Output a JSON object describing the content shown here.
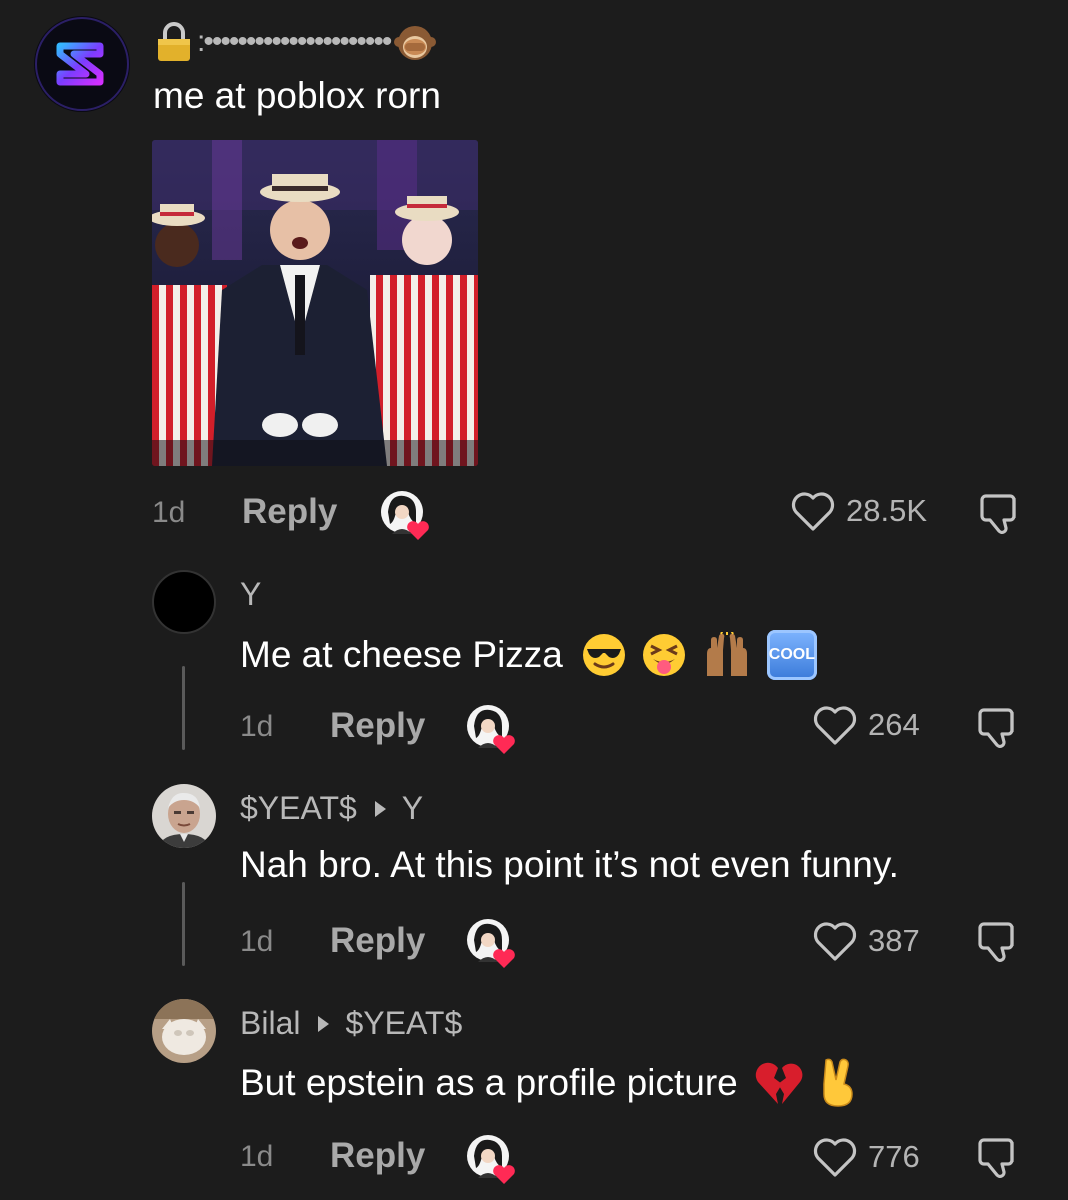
{
  "colors": {
    "background": "#1c1c1c",
    "text_primary": "#ffffff",
    "text_muted": "#a9a9a9",
    "heart_badge": "#ff2a55",
    "app_logo_accent": "#7b3dff"
  },
  "comments": [
    {
      "username": ":••••••••••••••••••••••",
      "username_icons": [
        "lock-icon",
        "see-no-evil-monkey-icon"
      ],
      "text": "me at poblox rorn",
      "has_image": true,
      "image_description": "meme-image",
      "age": "1d",
      "reply_label": "Reply",
      "likes": "28.5K"
    },
    {
      "username": "Y",
      "text": "Me at cheese Pizza",
      "emojis": [
        "sunglasses-emoji",
        "squinting-tongue-emoji",
        "raised-hands-emoji",
        "cool-button-emoji"
      ],
      "cool_label": "COOL",
      "age": "1d",
      "reply_label": "Reply",
      "likes": "264"
    },
    {
      "username": "$YEAT$",
      "reply_to": "Y",
      "text": "Nah bro. At this point it’s not even funny.",
      "age": "1d",
      "reply_label": "Reply",
      "likes": "387"
    },
    {
      "username": "Bilal",
      "reply_to": "$YEAT$",
      "text": "But epstein as a profile picture",
      "emojis": [
        "broken-heart-emoji",
        "victory-hand-emoji"
      ],
      "age": "1d",
      "reply_label": "Reply",
      "likes": "776"
    }
  ]
}
